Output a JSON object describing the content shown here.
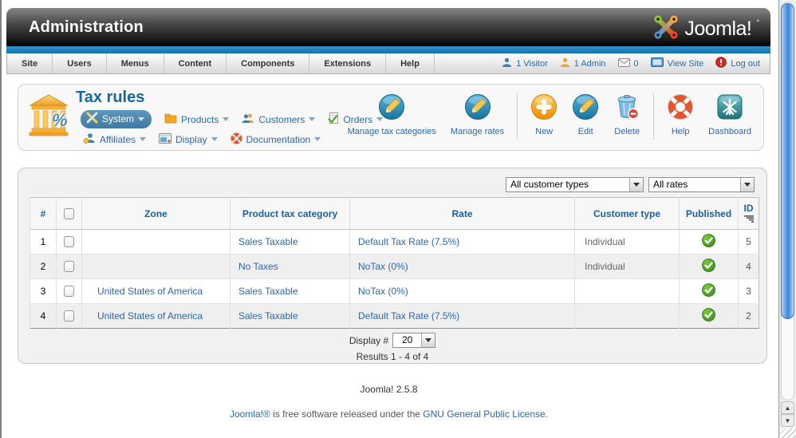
{
  "header": {
    "title": "Administration",
    "brand": "Joomla!"
  },
  "menubar": {
    "items": [
      "Site",
      "Users",
      "Menus",
      "Content",
      "Components",
      "Extensions",
      "Help"
    ]
  },
  "statusbar": {
    "visitors": "1 Visitor",
    "admins": "1 Admin",
    "messages": "0",
    "view_site": "View Site",
    "logout": "Log out"
  },
  "page": {
    "title": "Tax rules",
    "component_menu": {
      "row1": [
        {
          "label": "System",
          "active": true
        },
        {
          "label": "Products"
        },
        {
          "label": "Customers"
        },
        {
          "label": "Orders"
        }
      ],
      "row2": [
        {
          "label": "Affiliates"
        },
        {
          "label": "Display"
        },
        {
          "label": "Documentation"
        }
      ]
    },
    "toolbar": {
      "buttons": [
        "Manage tax categories",
        "Manage rates",
        "New",
        "Edit",
        "Delete",
        "Help",
        "Dashboard"
      ]
    }
  },
  "filters": {
    "customer_types": "All customer types",
    "rates": "All rates"
  },
  "table": {
    "headers": {
      "num": "#",
      "zone": "Zone",
      "category": "Product tax category",
      "rate": "Rate",
      "customer_type": "Customer type",
      "published": "Published",
      "id": "ID"
    },
    "rows": [
      {
        "num": "1",
        "zone": "",
        "category": "Sales Taxable",
        "rate": "Default Tax Rate (7.5%)",
        "customer_type": "Individual",
        "published": true,
        "id": "5"
      },
      {
        "num": "2",
        "zone": "",
        "category": "No Taxes",
        "rate": "NoTax (0%)",
        "customer_type": "Individual",
        "published": true,
        "id": "4"
      },
      {
        "num": "3",
        "zone": "United States of America",
        "category": "Sales Taxable",
        "rate": "NoTax (0%)",
        "customer_type": "",
        "published": true,
        "id": "3"
      },
      {
        "num": "4",
        "zone": "United States of America",
        "category": "Sales Taxable",
        "rate": "Default Tax Rate (7.5%)",
        "customer_type": "",
        "published": true,
        "id": "2"
      }
    ]
  },
  "pagination": {
    "display_label": "Display #",
    "display_value": "20",
    "results": "Results 1 - 4 of 4"
  },
  "footer": {
    "version": "Joomla! 2.5.8",
    "license": {
      "link1": "Joomla!®",
      "middle": " is free software released under the ",
      "link2": "GNU General Public License",
      "end": "."
    }
  },
  "colors": {
    "accent_blue": "#1172ae",
    "link_blue": "#2b67af",
    "title_blue": "#17689e",
    "published_green": "#3e8e1d",
    "panel_bg": "#f1f1f1"
  }
}
